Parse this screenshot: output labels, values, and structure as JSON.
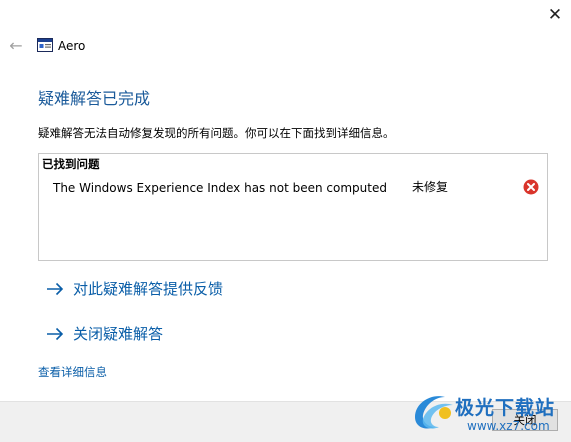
{
  "window": {
    "title": "Aero",
    "close_glyph": "✕",
    "back_glyph": "←"
  },
  "main": {
    "heading": "疑难解答已完成",
    "description": "疑难解答无法自动修复发现的所有问题。你可以在下面找到详细信息。",
    "problems_header": "已找到问题",
    "problems": [
      {
        "text": "The Windows Experience Index has not been computed",
        "status": "未修复",
        "icon": "error-icon"
      }
    ],
    "links": [
      {
        "label": "对此疑难解答提供反馈",
        "icon": "arrow-right-icon"
      },
      {
        "label": "关闭疑难解答",
        "icon": "arrow-right-icon"
      }
    ],
    "details_link": "查看详细信息"
  },
  "footer": {
    "close_label": "关闭"
  },
  "watermark": {
    "name": "极光下载站",
    "url": "www.xz7.com"
  },
  "colors": {
    "accent": "#0a5ea8",
    "heading": "#1a5a9a",
    "error": "#d9342b",
    "footer_bg": "#f0f0f0"
  }
}
